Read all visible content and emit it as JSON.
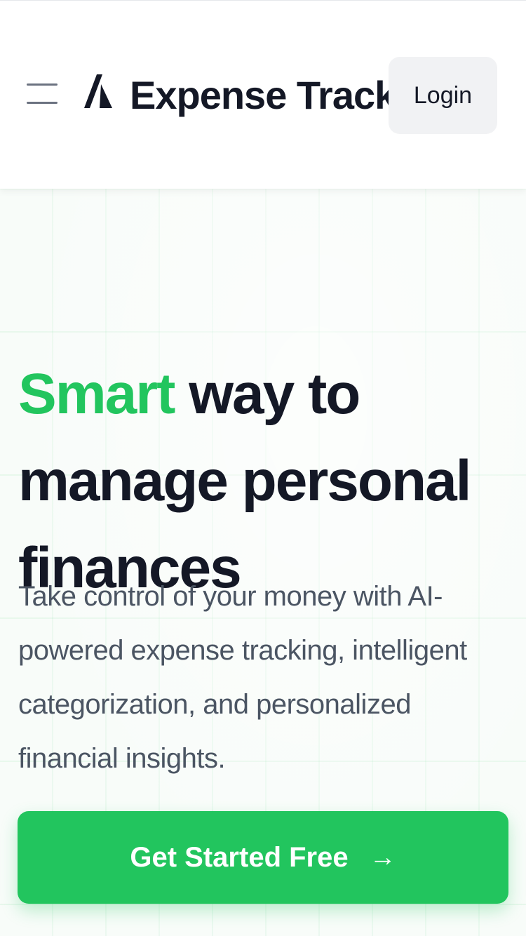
{
  "header": {
    "brand": "Expense Tracker",
    "login_label": "Login"
  },
  "hero": {
    "headline_accent": "Smart",
    "headline_rest": " way to manage personal finances",
    "subtitle": "Take control of your money with AI-powered expense tracking, intelligent categorization, and personalized financial insights.",
    "cta_label": "Get Started Free",
    "cta_arrow": "→"
  },
  "icons": {
    "menu": "hamburger-menu-icon",
    "logo": "logo-icon",
    "arrow": "arrow-right-icon"
  },
  "colors": {
    "accent": "#22c55e",
    "text": "#141826",
    "muted": "#4b5563",
    "login_bg": "#f1f2f4"
  }
}
